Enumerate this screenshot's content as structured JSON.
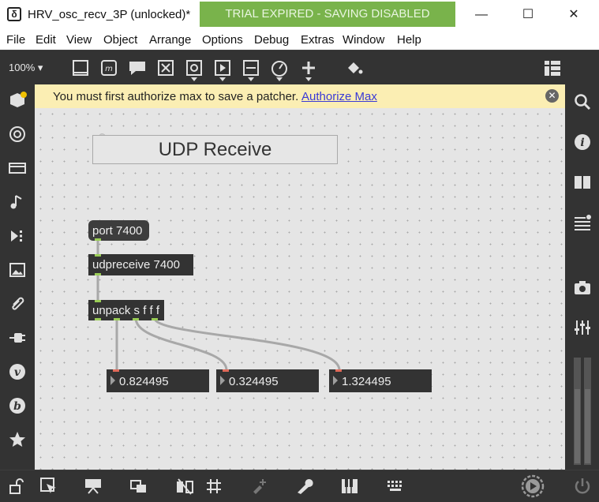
{
  "window": {
    "title": "HRV_osc_recv_3P (unlocked)*",
    "trial_banner": "TRIAL EXPIRED - SAVING DISABLED",
    "minimize": "—",
    "maximize": "☐",
    "close": "✕"
  },
  "menu": {
    "items": [
      "File",
      "Edit",
      "View",
      "Object",
      "Arrange",
      "Options",
      "Debug",
      "Extras",
      "Window",
      "Help"
    ]
  },
  "toolbar": {
    "zoom": "100%",
    "icons": [
      "presentation-icon",
      "message-icon",
      "comment-icon",
      "button-icon",
      "toggle-icon",
      "number-icon",
      "slider-icon",
      "dial-icon",
      "add-object-icon",
      "format-paint-icon",
      "grid-layout-icon"
    ]
  },
  "auth": {
    "message": "You must first authorize max to save a patcher.",
    "link": "Authorize Max",
    "close": "✕"
  },
  "patch": {
    "comment": "UDP Receive",
    "port_message": "port 7400",
    "udpreceive": "udpreceive 7400",
    "unpack": "unpack s f f f",
    "num1": "0.824495",
    "num2": "0.324495",
    "num3": "1.324495"
  },
  "sidebar_left": {
    "icons": [
      "package-icon",
      "target-icon",
      "media-icon",
      "music-icon",
      "video-icon",
      "image-icon",
      "attach-icon",
      "plug-icon",
      "vizzie-icon",
      "bpatcher-icon",
      "star-icon"
    ]
  },
  "sidebar_right": {
    "icons": [
      "search-icon",
      "info-icon",
      "book-icon",
      "list-icon",
      "camera-icon",
      "mixer-icon",
      "meter-icon"
    ]
  },
  "bottom": {
    "icons": [
      "lock-icon",
      "edit-mode-icon",
      "presentation-mode-icon",
      "layers-icon",
      "flip-icon",
      "grid-icon",
      "edit-connect-icon",
      "wrench-icon",
      "keyboard-piano-icon",
      "keyboard-icon",
      "play-icon",
      "power-icon"
    ]
  },
  "colors": {
    "trial_green": "#79b34b",
    "auth_yellow": "#fbeeb3",
    "canvas": "#e5e5e5",
    "object_bg": "#333333",
    "link_blue": "#3a3ad6",
    "cord": "#a8a8a8"
  }
}
